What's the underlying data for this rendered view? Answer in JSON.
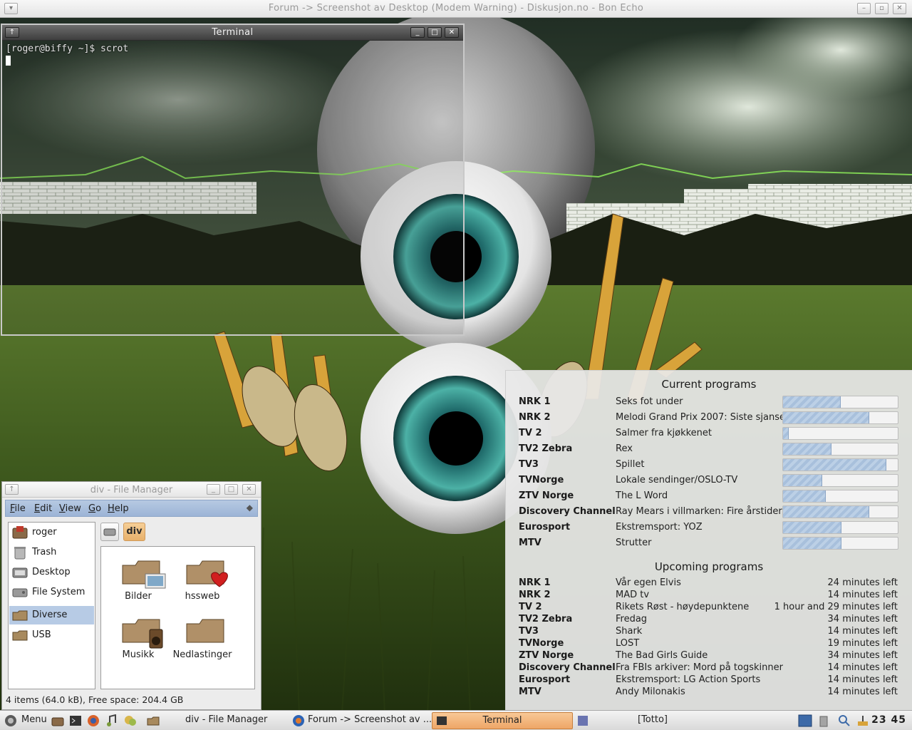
{
  "browser_window": {
    "title": "Forum -> Screenshot av Desktop (Modem Warning) - Diskusjon.no - Bon Echo"
  },
  "terminal": {
    "title": "Terminal",
    "prompt_line": "[roger@biffy ~]$ scrot"
  },
  "tv_widget": {
    "current_heading": "Current programs",
    "current": [
      {
        "channel": "NRK 1",
        "program": "Seks fot under",
        "progress": 0.5
      },
      {
        "channel": "NRK 2",
        "program": "Melodi Grand Prix 2007: Siste sjanse",
        "progress": 0.75
      },
      {
        "channel": "TV 2",
        "program": "Salmer fra kjøkkenet",
        "progress": 0.05
      },
      {
        "channel": "TV2 Zebra",
        "program": "Rex",
        "progress": 0.42
      },
      {
        "channel": "TV3",
        "program": "Spillet",
        "progress": 0.9
      },
      {
        "channel": "TVNorge",
        "program": "Lokale sendinger/OSLO-TV",
        "progress": 0.34
      },
      {
        "channel": "ZTV Norge",
        "program": "The L Word",
        "progress": 0.37
      },
      {
        "channel": "Discovery Channel",
        "program": "Ray Mears i villmarken: Fire årstider",
        "progress": 0.75
      },
      {
        "channel": "Eurosport",
        "program": "Ekstremsport: YOZ",
        "progress": 0.51
      },
      {
        "channel": "MTV",
        "program": "Strutter",
        "progress": 0.51
      }
    ],
    "upcoming_heading": "Upcoming programs",
    "upcoming": [
      {
        "channel": "NRK 1",
        "program": "Vår egen Elvis",
        "time_left": "24 minutes left"
      },
      {
        "channel": "NRK 2",
        "program": "MAD tv",
        "time_left": "14 minutes left"
      },
      {
        "channel": "TV 2",
        "program": "Rikets Røst - høydepunktene",
        "time_left": "1 hour and 29 minutes left"
      },
      {
        "channel": "TV2 Zebra",
        "program": "Fredag",
        "time_left": "34 minutes left"
      },
      {
        "channel": "TV3",
        "program": "Shark",
        "time_left": "14 minutes left"
      },
      {
        "channel": "TVNorge",
        "program": "LOST",
        "time_left": "19 minutes left"
      },
      {
        "channel": "ZTV Norge",
        "program": "The Bad Girls Guide",
        "time_left": "34 minutes left"
      },
      {
        "channel": "Discovery Channel",
        "program": "Fra FBIs arkiver: Mord på togskinner",
        "time_left": "14 minutes left"
      },
      {
        "channel": "Eurosport",
        "program": "Ekstremsport: LG Action Sports",
        "time_left": "14 minutes left"
      },
      {
        "channel": "MTV",
        "program": "Andy Milonakis",
        "time_left": "14 minutes left"
      }
    ]
  },
  "file_manager": {
    "title": "div - File Manager",
    "menu": [
      "File",
      "Edit",
      "View",
      "Go",
      "Help"
    ],
    "sidebar": [
      {
        "label": "roger",
        "icon": "home-folder-icon",
        "selected": false
      },
      {
        "label": "Trash",
        "icon": "trash-icon",
        "selected": false
      },
      {
        "label": "Desktop",
        "icon": "desktop-icon",
        "selected": false
      },
      {
        "label": "File System",
        "icon": "harddisk-icon",
        "selected": false
      },
      {
        "label": "Diverse",
        "icon": "folder-icon",
        "selected": true
      },
      {
        "label": "USB",
        "icon": "folder-icon",
        "selected": false
      }
    ],
    "path_current": "div",
    "items": [
      {
        "label": "Bilder",
        "icon": "pictures-folder-icon"
      },
      {
        "label": "hssweb",
        "icon": "favorite-folder-icon"
      },
      {
        "label": "Musikk",
        "icon": "music-folder-icon"
      },
      {
        "label": "Nedlastinger",
        "icon": "folder-icon"
      }
    ],
    "status": "4 items (64.0 kB), Free space: 204.4 GB"
  },
  "panel": {
    "menu_label": "Menu",
    "tasks": [
      {
        "label": "div - File Manager",
        "active": false
      },
      {
        "label": "Forum -> Screenshot av ...",
        "active": false
      },
      {
        "label": "Terminal",
        "active": true
      },
      {
        "label": "[Totto]",
        "active": false
      }
    ],
    "clock": "23 45"
  },
  "colors": {
    "selection": "#b7cbe5",
    "menubar": "#a9bfdd",
    "active_task": "#f2b57a",
    "progress_fill": "#a8c0dc"
  }
}
